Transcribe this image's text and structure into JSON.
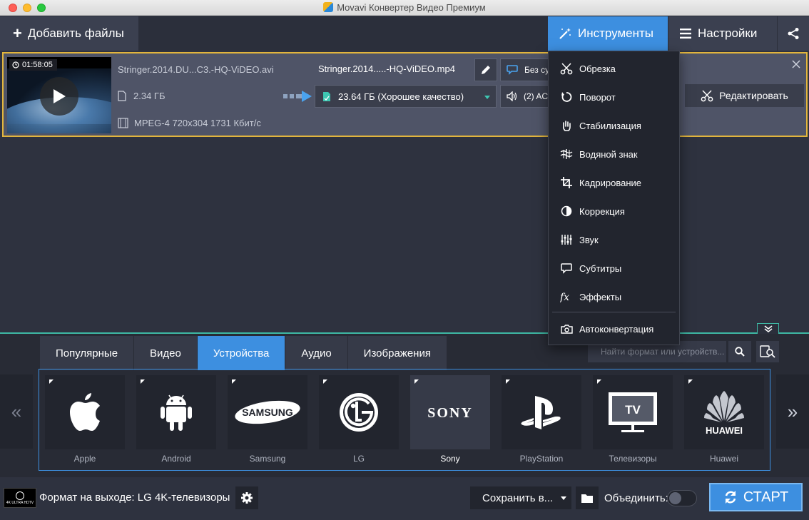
{
  "window": {
    "title": "Movavi Конвертер Видео Премиум"
  },
  "toolbar": {
    "add_files": "Добавить файлы",
    "tools": "Инструменты",
    "settings": "Настройки"
  },
  "file": {
    "duration": "01:58:05",
    "source_name": "Stringer.2014.DU...C3.-HQ-ViDEO.avi",
    "source_size": "2.34 ГБ",
    "source_format": "MPEG-4 720x304 1731 Кбит/с",
    "output_name": "Stringer.2014.....-HQ-ViDEO.mp4",
    "output_size": "23.64 ГБ (Хорошее качество)",
    "subtitles": "Без су",
    "audio": "(2) AC",
    "edit_label": "Редактировать"
  },
  "tools_menu": {
    "items": [
      {
        "label": "Обрезка",
        "icon": "scissors-icon"
      },
      {
        "label": "Поворот",
        "icon": "rotate-icon"
      },
      {
        "label": "Стабилизация",
        "icon": "hand-icon"
      },
      {
        "label": "Водяной знак",
        "icon": "watermark-icon"
      },
      {
        "label": "Кадрирование",
        "icon": "crop-icon"
      },
      {
        "label": "Коррекция",
        "icon": "correction-icon"
      },
      {
        "label": "Звук",
        "icon": "equalizer-icon"
      },
      {
        "label": "Субтитры",
        "icon": "subtitles-icon"
      },
      {
        "label": "Эффекты",
        "icon": "fx-icon"
      }
    ],
    "auto": {
      "label": "Автоконвертация",
      "icon": "camera-icon"
    }
  },
  "format_tabs": [
    {
      "label": "Популярные",
      "active": false
    },
    {
      "label": "Видео",
      "active": false
    },
    {
      "label": "Устройства",
      "active": true
    },
    {
      "label": "Аудио",
      "active": false
    },
    {
      "label": "Изображения",
      "active": false
    }
  ],
  "search": {
    "placeholder": "Найти формат или устройств..."
  },
  "devices": [
    {
      "label": "Apple",
      "icon": "apple-logo-icon",
      "selected": false
    },
    {
      "label": "Android",
      "icon": "android-logo-icon",
      "selected": false
    },
    {
      "label": "Samsung",
      "icon": "samsung-logo-icon",
      "selected": false,
      "logo_text": "SAMSUNG"
    },
    {
      "label": "LG",
      "icon": "lg-logo-icon",
      "selected": false
    },
    {
      "label": "Sony",
      "icon": "sony-logo-icon",
      "selected": true,
      "logo_text": "SONY"
    },
    {
      "label": "PlayStation",
      "icon": "playstation-logo-icon",
      "selected": false
    },
    {
      "label": "Телевизоры",
      "icon": "tv-icon",
      "selected": false,
      "logo_text": "TV"
    },
    {
      "label": "Huawei",
      "icon": "huawei-logo-icon",
      "selected": false,
      "logo_text": "HUAWEI"
    }
  ],
  "nav": {
    "prev": "«",
    "next": "»"
  },
  "footer": {
    "output_format": "Формат на выходе: LG 4K-телевизоры",
    "format_icon_text": "4K ULTRA HDTV",
    "save_to": "Сохранить в...",
    "merge": "Объединить:",
    "merge_on": false,
    "start": "СТАРТ"
  },
  "colors": {
    "accent": "#3d8fe0",
    "highlight": "#e2b53d",
    "teal": "#3eb8a4"
  }
}
